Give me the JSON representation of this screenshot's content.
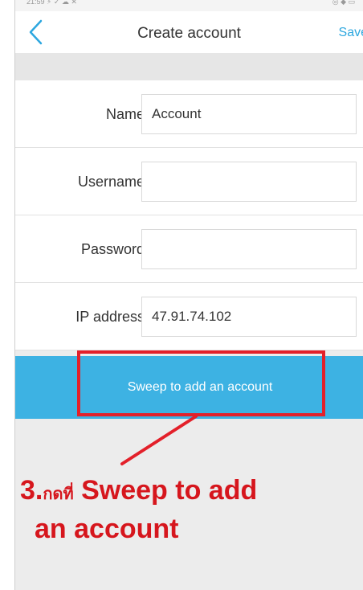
{
  "status_bar": {
    "left": "21:59 ⚡ ✓ ☁ ✕",
    "right": "◎ ◆ ▭"
  },
  "nav": {
    "title": "Create account",
    "save_label": "Save",
    "back_icon": "chevron-left-icon"
  },
  "form": {
    "fields": [
      {
        "label": "Name :",
        "value": "Account",
        "placeholder": ""
      },
      {
        "label": "Username :",
        "value": "",
        "placeholder": ""
      },
      {
        "label": "Password :",
        "value": "",
        "placeholder": ""
      },
      {
        "label": "IP address :",
        "value": "47.91.74.102",
        "placeholder": ""
      }
    ]
  },
  "sweep": {
    "label": "Sweep to add an account"
  },
  "annotation": {
    "step": "3.",
    "thai": "กดที่",
    "line1": "Sweep to add",
    "line2": "an account"
  },
  "colors": {
    "accent": "#3db2e3",
    "highlight": "#e3202a",
    "annotation": "#d6161d"
  }
}
